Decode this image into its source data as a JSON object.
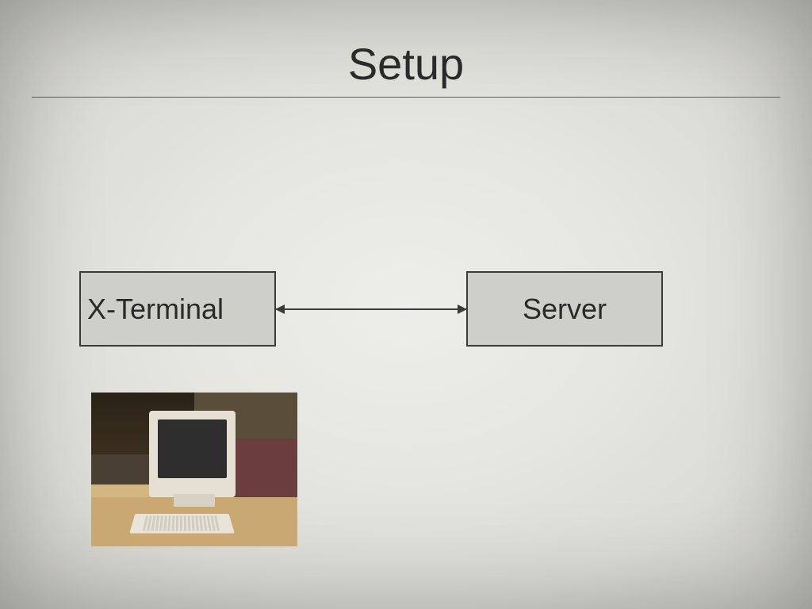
{
  "title": "Setup",
  "diagram": {
    "left_box_label": "X-Terminal",
    "right_box_label": "Server"
  }
}
